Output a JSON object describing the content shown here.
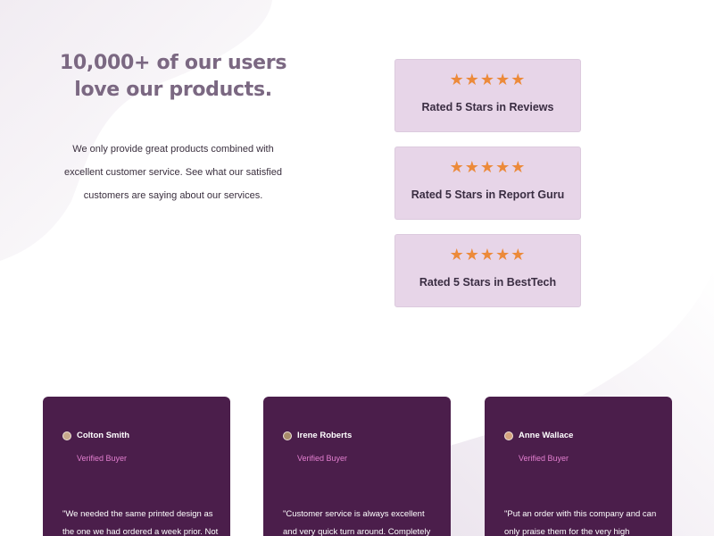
{
  "hero": {
    "title": "10,000+ of our users love our products.",
    "description": "We only provide great products combined with excellent customer service. See what our satisfied customers are saying about our services."
  },
  "ratings": [
    {
      "stars": "★★★★★",
      "label": "Rated 5 Stars in Reviews",
      "score": 5,
      "max": 5
    },
    {
      "stars": "★★★★★",
      "label": "Rated 5 Stars in Report Guru",
      "score": 5,
      "max": 5
    },
    {
      "stars": "★★★★★",
      "label": "Rated 5 Stars in BestTech",
      "score": 5,
      "max": 5
    }
  ],
  "testimonials": [
    {
      "name": "Colton Smith",
      "badge": "Verified Buyer",
      "quote": "\"We needed the same printed design as the one we had ordered a week prior. Not only did they find"
    },
    {
      "name": "Irene Roberts",
      "badge": "Verified Buyer",
      "quote": "\"Customer service is always excellent and very quick turn around. Completely delighted with the"
    },
    {
      "name": "Anne Wallace",
      "badge": "Verified Buyer",
      "quote": "\"Put an order with this company and can only praise them for the very high standard. Will"
    }
  ],
  "colors": {
    "accent_star": "#ec8a3a",
    "card_bg": "#e7d5e8",
    "testimonial_bg": "#4b1e4b",
    "badge": "#e37fd0",
    "title": "#7b6882"
  }
}
